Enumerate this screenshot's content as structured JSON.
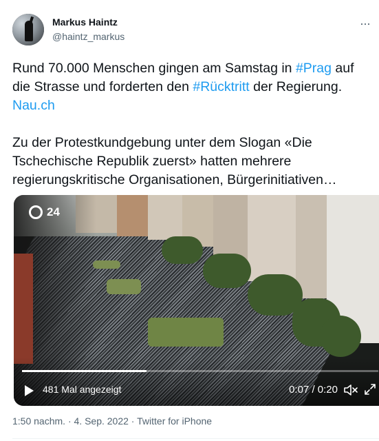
{
  "author": {
    "name": "Markus Haintz",
    "handle": "@haintz_markus"
  },
  "tweet": {
    "p1_before": "Rund 70.000 Menschen gingen am Samstag in ",
    "p1_tag1": "#Prag",
    "p1_mid": " auf die Strasse und forderten den ",
    "p1_tag2": "#Rücktritt",
    "p1_after": " der Regierung. ",
    "p1_link": "Nau.ch",
    "p2": "Zu der Protestkundgebung unter dem Slogan «Die Tschechische Republik zuerst» hatten mehrere regierungskritische Organisationen, Bürgerinitiativen…"
  },
  "video": {
    "channel_logo": "24",
    "views": "481 Mal angezeigt",
    "time": "0:07 / 0:20",
    "progress": 0.35
  },
  "meta": {
    "time": "1:50 nachm.",
    "sep1": " · ",
    "date": "4. Sep. 2022",
    "sep2": " · ",
    "source": "Twitter for iPhone"
  },
  "colors": {
    "link": "#1d9bf0",
    "secondary_text": "#536471"
  },
  "icons": [
    "more-icon",
    "play-icon",
    "mute-icon",
    "expand-icon"
  ]
}
